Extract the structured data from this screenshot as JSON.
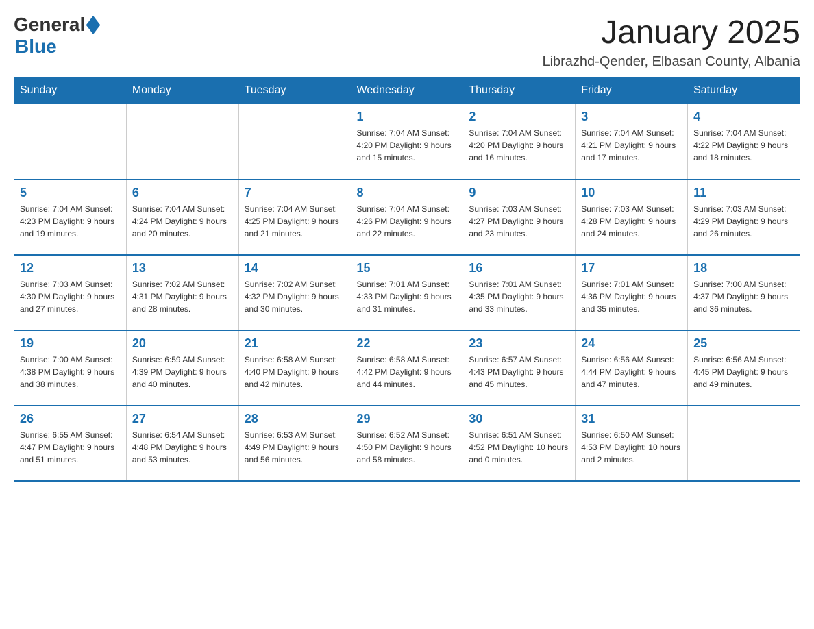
{
  "header": {
    "logo_general": "General",
    "logo_blue": "Blue",
    "month_title": "January 2025",
    "location": "Librazhd-Qender, Elbasan County, Albania"
  },
  "days_of_week": [
    "Sunday",
    "Monday",
    "Tuesday",
    "Wednesday",
    "Thursday",
    "Friday",
    "Saturday"
  ],
  "weeks": [
    [
      {
        "day": "",
        "info": ""
      },
      {
        "day": "",
        "info": ""
      },
      {
        "day": "",
        "info": ""
      },
      {
        "day": "1",
        "info": "Sunrise: 7:04 AM\nSunset: 4:20 PM\nDaylight: 9 hours and 15 minutes."
      },
      {
        "day": "2",
        "info": "Sunrise: 7:04 AM\nSunset: 4:20 PM\nDaylight: 9 hours and 16 minutes."
      },
      {
        "day": "3",
        "info": "Sunrise: 7:04 AM\nSunset: 4:21 PM\nDaylight: 9 hours and 17 minutes."
      },
      {
        "day": "4",
        "info": "Sunrise: 7:04 AM\nSunset: 4:22 PM\nDaylight: 9 hours and 18 minutes."
      }
    ],
    [
      {
        "day": "5",
        "info": "Sunrise: 7:04 AM\nSunset: 4:23 PM\nDaylight: 9 hours and 19 minutes."
      },
      {
        "day": "6",
        "info": "Sunrise: 7:04 AM\nSunset: 4:24 PM\nDaylight: 9 hours and 20 minutes."
      },
      {
        "day": "7",
        "info": "Sunrise: 7:04 AM\nSunset: 4:25 PM\nDaylight: 9 hours and 21 minutes."
      },
      {
        "day": "8",
        "info": "Sunrise: 7:04 AM\nSunset: 4:26 PM\nDaylight: 9 hours and 22 minutes."
      },
      {
        "day": "9",
        "info": "Sunrise: 7:03 AM\nSunset: 4:27 PM\nDaylight: 9 hours and 23 minutes."
      },
      {
        "day": "10",
        "info": "Sunrise: 7:03 AM\nSunset: 4:28 PM\nDaylight: 9 hours and 24 minutes."
      },
      {
        "day": "11",
        "info": "Sunrise: 7:03 AM\nSunset: 4:29 PM\nDaylight: 9 hours and 26 minutes."
      }
    ],
    [
      {
        "day": "12",
        "info": "Sunrise: 7:03 AM\nSunset: 4:30 PM\nDaylight: 9 hours and 27 minutes."
      },
      {
        "day": "13",
        "info": "Sunrise: 7:02 AM\nSunset: 4:31 PM\nDaylight: 9 hours and 28 minutes."
      },
      {
        "day": "14",
        "info": "Sunrise: 7:02 AM\nSunset: 4:32 PM\nDaylight: 9 hours and 30 minutes."
      },
      {
        "day": "15",
        "info": "Sunrise: 7:01 AM\nSunset: 4:33 PM\nDaylight: 9 hours and 31 minutes."
      },
      {
        "day": "16",
        "info": "Sunrise: 7:01 AM\nSunset: 4:35 PM\nDaylight: 9 hours and 33 minutes."
      },
      {
        "day": "17",
        "info": "Sunrise: 7:01 AM\nSunset: 4:36 PM\nDaylight: 9 hours and 35 minutes."
      },
      {
        "day": "18",
        "info": "Sunrise: 7:00 AM\nSunset: 4:37 PM\nDaylight: 9 hours and 36 minutes."
      }
    ],
    [
      {
        "day": "19",
        "info": "Sunrise: 7:00 AM\nSunset: 4:38 PM\nDaylight: 9 hours and 38 minutes."
      },
      {
        "day": "20",
        "info": "Sunrise: 6:59 AM\nSunset: 4:39 PM\nDaylight: 9 hours and 40 minutes."
      },
      {
        "day": "21",
        "info": "Sunrise: 6:58 AM\nSunset: 4:40 PM\nDaylight: 9 hours and 42 minutes."
      },
      {
        "day": "22",
        "info": "Sunrise: 6:58 AM\nSunset: 4:42 PM\nDaylight: 9 hours and 44 minutes."
      },
      {
        "day": "23",
        "info": "Sunrise: 6:57 AM\nSunset: 4:43 PM\nDaylight: 9 hours and 45 minutes."
      },
      {
        "day": "24",
        "info": "Sunrise: 6:56 AM\nSunset: 4:44 PM\nDaylight: 9 hours and 47 minutes."
      },
      {
        "day": "25",
        "info": "Sunrise: 6:56 AM\nSunset: 4:45 PM\nDaylight: 9 hours and 49 minutes."
      }
    ],
    [
      {
        "day": "26",
        "info": "Sunrise: 6:55 AM\nSunset: 4:47 PM\nDaylight: 9 hours and 51 minutes."
      },
      {
        "day": "27",
        "info": "Sunrise: 6:54 AM\nSunset: 4:48 PM\nDaylight: 9 hours and 53 minutes."
      },
      {
        "day": "28",
        "info": "Sunrise: 6:53 AM\nSunset: 4:49 PM\nDaylight: 9 hours and 56 minutes."
      },
      {
        "day": "29",
        "info": "Sunrise: 6:52 AM\nSunset: 4:50 PM\nDaylight: 9 hours and 58 minutes."
      },
      {
        "day": "30",
        "info": "Sunrise: 6:51 AM\nSunset: 4:52 PM\nDaylight: 10 hours and 0 minutes."
      },
      {
        "day": "31",
        "info": "Sunrise: 6:50 AM\nSunset: 4:53 PM\nDaylight: 10 hours and 2 minutes."
      },
      {
        "day": "",
        "info": ""
      }
    ]
  ]
}
